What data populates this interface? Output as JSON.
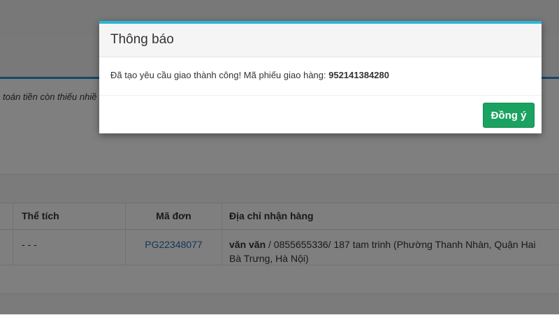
{
  "background": {
    "note_text": "toán tiền còn thiếu nhiề",
    "table": {
      "headers": [
        "Thể tích",
        "Mã đơn",
        "Địa chỉ nhận hàng"
      ],
      "rows": [
        {
          "volume": "- - -",
          "order_code": "PG22348077",
          "recipient_name": "văn văn",
          "address_rest": " / 0855655336/ 187 tam trinh (Phường Thanh Nhàn, Quận Hai Bà Trưng, Hà Nội)"
        }
      ]
    }
  },
  "modal": {
    "title": "Thông báo",
    "message": "Đã tạo yêu cầu giao thành công! Mã phiếu giao hàng: ",
    "delivery_code": "952141384280",
    "ok_label": "Đồng ý"
  },
  "colors": {
    "accent_blue": "#2a8fd4",
    "modal_top_border": "#29b6d8",
    "ok_button": "#1aa260",
    "link": "#2a6eaf"
  }
}
